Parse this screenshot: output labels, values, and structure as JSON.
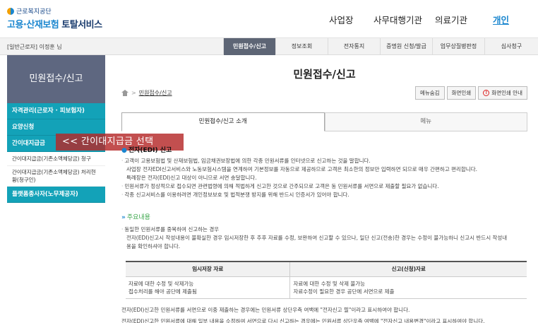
{
  "header": {
    "org_small": "근로복지공단",
    "title_part1": "고용·산재보험",
    "title_part2": " 토탈서비스",
    "nav": [
      "사업장",
      "사무대행기관",
      "의료기관",
      "개인"
    ]
  },
  "subbar": {
    "user": "[일반근로자] 이정훈 님",
    "tabs": [
      "민원접수/신고",
      "정보조회",
      "전자통지",
      "증명원 신청/발급",
      "업무상질병판정",
      "심사청구"
    ]
  },
  "sidebar": {
    "heading": "민원접수/신고",
    "items": [
      "자격관리(근로자 · 피보험자)",
      "요양신청",
      "간이대지급금"
    ],
    "sub_items": [
      "간이대지급금(기존소액체당금) 청구",
      "간이대지급금(기존소액체당금) 처리현황(청구인)"
    ],
    "last_item": "플랫폼종사자(노무제공자)"
  },
  "main": {
    "title": "민원접수/신고",
    "breadcrumb": "민원접수/신고",
    "actions": [
      "메뉴숨김",
      "화면인쇄",
      "화면인쇄 안내"
    ],
    "tabs": [
      "민원접수/신고 소개",
      "메뉴"
    ],
    "overlay": "<< 간이대지급금 선택",
    "section1_title": "전자(EDI) 신고",
    "section1_lines": [
      "고객이 고용보험법 및 산재보험법, 임금채권보장법에 의한 각종 민원서류를 인터넷으로 신고하는 것을 말합니다.",
      "사업장 전자EDI신고서비스와 노동보험시스템을 연계하여 기본정보를 자동으로 제공하므로 고객은 최소한의 정보만 입력하면 되므로 매우 간편하고 편리합니다.",
      "특례장은 전자(EDI)신고 대상이 아니므로 서면 송달합니다.",
      "민원서류가 정상적으로 접수되면 관련법령에 의해 적법하게 신고한 것으로 간주되므로 고객은 동 민원서류를 서면으로 제출할 필요가 없습니다.",
      "각종 신고서비스를 이용하려면 개인정보보호 및 법적분쟁 방지를 위해 반드시 인증서가 있어야 합니다."
    ],
    "section2_title": "주요내용",
    "section2_lines": [
      "동일한 민원서류를 중복하여 신고하는 경우",
      "전자(EDI)신고시 작성내용이 불확실한 경우 임시저장한 후 추후 자료를 수정, 보완하여 신고할 수 있으나, 일단 신고(전송)한 경우는 수정이 불가능하니 신고시 반드시 작성내",
      "용을 확인하셔야 합니다."
    ],
    "table": {
      "headers": [
        "임시저장 자료",
        "신고(신청)자료"
      ],
      "rows": [
        [
          "자료에 대한 수정 및 삭제가능",
          "자료에 대한 수정 및 삭제 불가능"
        ],
        [
          "접수처리를 해야 공단에 제출됨",
          "자료수정이 필요한 경우 공단에 서면으로 제출"
        ]
      ]
    },
    "footer_lines": [
      "전자(EDI)신고한 민원서류를 서면으로 이중 제출하는 경우에는 민원서류 상단우측 여백에 \"전자신고 필\"이라고 표시하여야 합니다.",
      "전자(EDI)신고한 민원서류에 대해 일부 내용을 수정하여 서면으로 다시 신고하는 경우에는 민원서류 상단우측 여백에 \"전자신고 내용변경\"이라고 표시하여야 합니다."
    ]
  }
}
